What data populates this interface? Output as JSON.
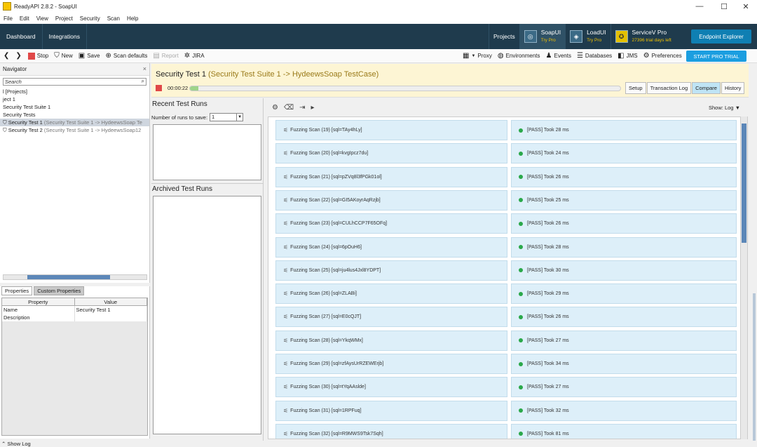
{
  "window": {
    "title": "ReadyAPI 2.8.2 - SoapUI",
    "minimize": "—",
    "maximize": "☐",
    "close": "✕"
  },
  "menu": [
    "File",
    "Edit",
    "View",
    "Project",
    "Security",
    "Scan",
    "Help"
  ],
  "nav": {
    "tabs": [
      "Dashboard",
      "Integrations"
    ],
    "projects": "Projects",
    "products": [
      {
        "name": "SoapUI",
        "sub": "Try Pro",
        "icon": "◎"
      },
      {
        "name": "LoadUI",
        "sub": "Try Pro",
        "icon": "◈"
      },
      {
        "name": "ServiceV Pro",
        "sub": "27396 trial days left",
        "icon": "✪"
      }
    ],
    "endpoint_explorer": "Endpoint Explorer"
  },
  "toolbar": {
    "stop": "Stop",
    "new": "New",
    "save": "Save",
    "scan_defaults": "Scan defaults",
    "report": "Report",
    "jira": "JIRA",
    "proxy": "Proxy",
    "environments": "Environments",
    "events": "Events",
    "databases": "Databases",
    "jms": "JMS",
    "preferences": "Preferences",
    "pro_trial": "START PRO TRIAL"
  },
  "navigator": {
    "title": "Navigator",
    "close": "×",
    "search_placeholder": "Search",
    "items": [
      {
        "label": "l [Projects]",
        "sub": ""
      },
      {
        "label": "ject 1",
        "sub": ""
      },
      {
        "label": "Security Test Suite 1",
        "sub": ""
      },
      {
        "label": "Security Tests",
        "sub": ""
      },
      {
        "label": "Security Test 1",
        "sub": " (Security Test Suite 1 -> HydeewsSoap Te"
      },
      {
        "label": "Security Test 2",
        "sub": " (Security Test Suite 1 -> HydeewsSoap12"
      }
    ]
  },
  "properties": {
    "tabs": [
      "Properties",
      "Custom Properties"
    ],
    "headers": [
      "Property",
      "Value"
    ],
    "rows": [
      [
        "Name",
        "Security Test 1"
      ],
      [
        "Description",
        ""
      ]
    ]
  },
  "show_log": "Show Log",
  "main": {
    "title": "Security Test 1",
    "suite": " (Security Test Suite 1 -> HydeewsSoap TestCase)",
    "elapsed": "00:00:22",
    "progress": 0.02,
    "tabs": [
      "Setup",
      "Transaction Log",
      "Compare",
      "History"
    ],
    "active_tab": "Compare"
  },
  "recent": {
    "title": "Recent Test Runs",
    "runs_label": "Number of runs to save:",
    "runs_value": "1",
    "archived_title": "Archived Test Runs"
  },
  "log": {
    "show_label": "Show:",
    "show_value": "Log",
    "rows": [
      {
        "scan": "Fuzzing Scan (19) [sql=TAy4hLy]",
        "result": "[PASS] Took 28 ms"
      },
      {
        "scan": "Fuzzing Scan (20) [sql=kvgIpcz7du]",
        "result": "[PASS] Took 24 ms"
      },
      {
        "scan": "Fuzzing Scan (21) [sql=pZVq8l3fPGk01ol]",
        "result": "[PASS] Took 26 ms"
      },
      {
        "scan": "Fuzzing Scan (22) [sql=GI5AKoyrAqRzjb]",
        "result": "[PASS] Took 25 ms"
      },
      {
        "scan": "Fuzzing Scan (23) [sql=CULhCCP7F65OFq]",
        "result": "[PASS] Took 26 ms"
      },
      {
        "scan": "Fuzzing Scan (24) [sql=6pOuH6]",
        "result": "[PASS] Took 28 ms"
      },
      {
        "scan": "Fuzzing Scan (25) [sql=ju4lus4Jxl8YDPT]",
        "result": "[PASS] Took 30 ms"
      },
      {
        "scan": "Fuzzing Scan (26) [sql=ZLABi]",
        "result": "[PASS] Took 29 ms"
      },
      {
        "scan": "Fuzzing Scan (27) [sql=E0cQJT]",
        "result": "[PASS] Took 26 ms"
      },
      {
        "scan": "Fuzzing Scan (28) [sql=YkqWMx]",
        "result": "[PASS] Took 27 ms"
      },
      {
        "scan": "Fuzzing Scan (29) [sql=zfAysUrRZEWErjb]",
        "result": "[PASS] Took 34 ms"
      },
      {
        "scan": "Fuzzing Scan (30) [sql=tYqAAslde]",
        "result": "[PASS] Took 27 ms"
      },
      {
        "scan": "Fuzzing Scan (31) [sql=1RPFuq]",
        "result": "[PASS] Took 32 ms"
      },
      {
        "scan": "Fuzzing Scan (32) [sql=R9MWS9Tsk7Sqh]",
        "result": "[PASS] Took 81 ms"
      }
    ]
  }
}
